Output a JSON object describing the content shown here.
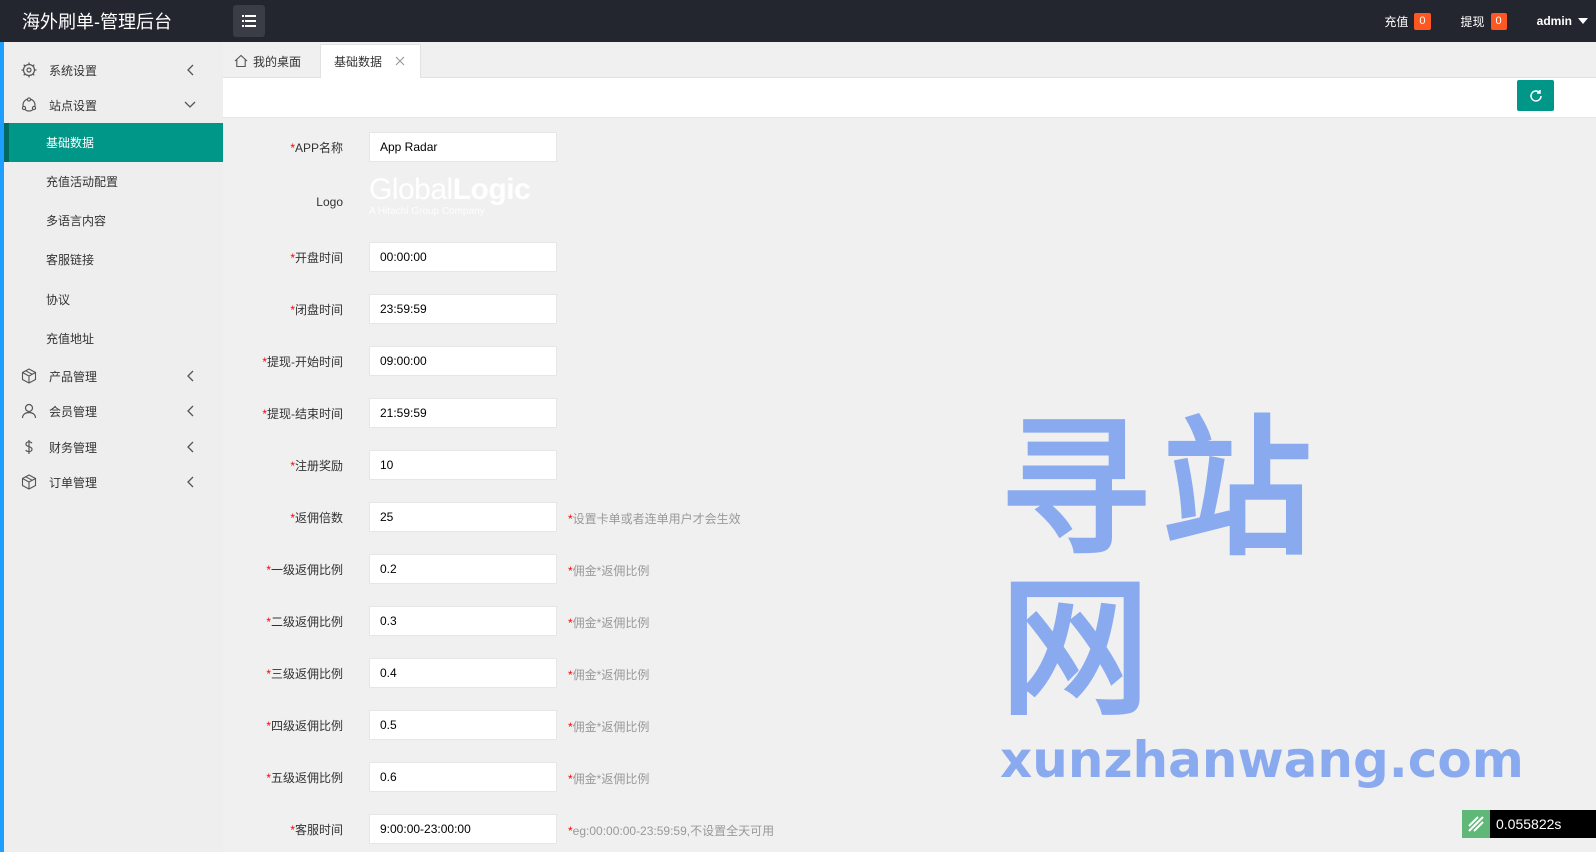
{
  "header": {
    "title": "海外刷单-管理后台",
    "recharge_label": "充值",
    "recharge_count": "0",
    "withdraw_label": "提现",
    "withdraw_count": "0",
    "user": "admin"
  },
  "sidebar": {
    "items": [
      {
        "label": "系统设置",
        "icon": "gear-icon"
      },
      {
        "label": "站点设置",
        "icon": "site-icon"
      },
      {
        "label": "产品管理",
        "icon": "box-icon"
      },
      {
        "label": "会员管理",
        "icon": "user-icon"
      },
      {
        "label": "财务管理",
        "icon": "dollar-icon"
      },
      {
        "label": "订单管理",
        "icon": "box-icon"
      }
    ],
    "sub_items": [
      "基础数据",
      "充值活动配置",
      "多语言内容",
      "客服链接",
      "协议",
      "充值地址"
    ]
  },
  "tabs": {
    "home": "我的桌面",
    "active": "基础数据"
  },
  "colors": {
    "accent": "#009688",
    "header_bg": "#23262e",
    "badge": "#ff5722",
    "rail": "#1e9fff"
  },
  "form": {
    "required_mark": "*",
    "logo_label": "Logo",
    "logo_text_light": "Global",
    "logo_text_bold": "Logic",
    "logo_sub": "A Hitachi Group Company",
    "fields": [
      {
        "label": "APP名称",
        "value": "App Radar",
        "hint": ""
      },
      {
        "label": "开盘时间",
        "value": "00:00:00",
        "hint": ""
      },
      {
        "label": "闭盘时间",
        "value": "23:59:59",
        "hint": ""
      },
      {
        "label": "提现-开始时间",
        "value": "09:00:00",
        "hint": ""
      },
      {
        "label": "提现-结束时间",
        "value": "21:59:59",
        "hint": ""
      },
      {
        "label": "注册奖励",
        "value": "10",
        "hint": ""
      },
      {
        "label": "返佣倍数",
        "value": "25",
        "hint": "设置卡单或者连单用户才会生效"
      },
      {
        "label": "一级返佣比例",
        "value": "0.2",
        "hint": "佣金*返佣比例"
      },
      {
        "label": "二级返佣比例",
        "value": "0.3",
        "hint": "佣金*返佣比例"
      },
      {
        "label": "三级返佣比例",
        "value": "0.4",
        "hint": "佣金*返佣比例"
      },
      {
        "label": "四级返佣比例",
        "value": "0.5",
        "hint": "佣金*返佣比例"
      },
      {
        "label": "五级返佣比例",
        "value": "0.6",
        "hint": "佣金*返佣比例"
      },
      {
        "label": "客服时间",
        "value": "9:00:00-23:00:00",
        "hint": "eg:00:00:00-23:59:59,不设置全天可用"
      }
    ]
  },
  "watermark": {
    "cn": "寻站网",
    "en": "xunzhanwang.com"
  },
  "timer": "0.055822s"
}
